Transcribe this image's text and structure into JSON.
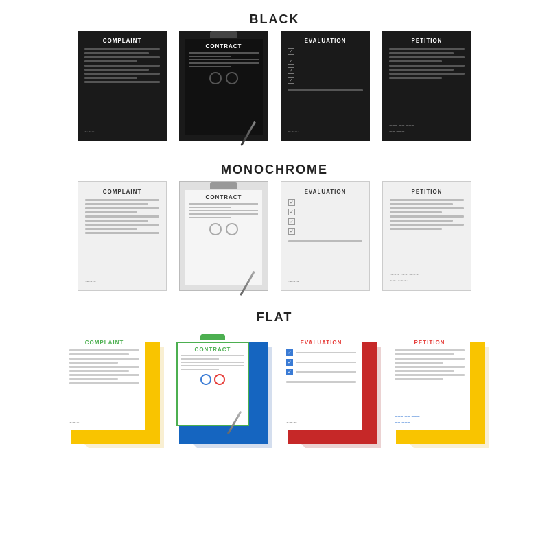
{
  "sections": {
    "black": {
      "label": "BLACK"
    },
    "monochrome": {
      "label": "MONOCHROME"
    },
    "flat": {
      "label": "FLAT"
    }
  },
  "documents": {
    "complaint": "COMPLAINT",
    "contract": "CONTRACT",
    "evaluation": "EVALUATION",
    "petition": "PETITION"
  },
  "colors": {
    "complaint_flat_title": "#4caf50",
    "contract_flat_title": "#4caf50",
    "evaluation_flat_title": "#e53935",
    "petition_flat_title": "#e53935",
    "complaint_flat_bg": "#f9c400",
    "contract_flat_bg": "#1565c0",
    "evaluation_flat_bg": "#c62828",
    "petition_flat_bg": "#f9c400",
    "contract_flat_border": "#4caf50"
  }
}
